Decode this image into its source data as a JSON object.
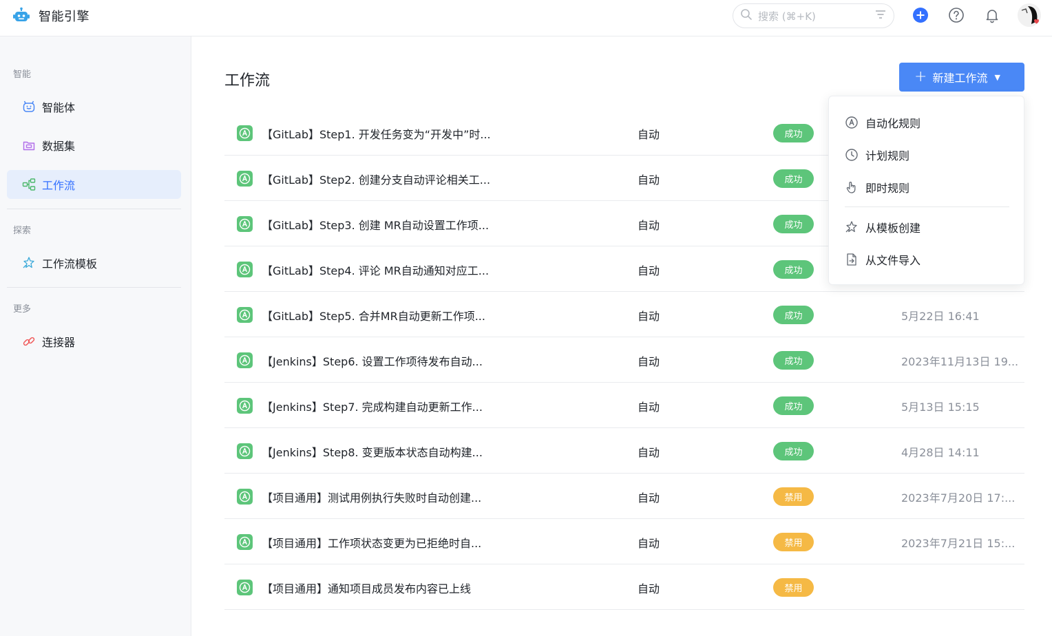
{
  "app": {
    "title": "智能引擎"
  },
  "search": {
    "placeholder": "搜索 (⌘+K)"
  },
  "sidebar": {
    "sections": [
      {
        "label": "智能"
      },
      {
        "label": "探索"
      },
      {
        "label": "更多"
      }
    ],
    "items": [
      {
        "label": "智能体",
        "icon": "robot-icon"
      },
      {
        "label": "数据集",
        "icon": "dataset-icon"
      },
      {
        "label": "工作流",
        "icon": "workflow-icon",
        "active": true
      },
      {
        "label": "工作流模板",
        "icon": "template-icon"
      },
      {
        "label": "连接器",
        "icon": "connector-icon"
      }
    ]
  },
  "main": {
    "title": "工作流",
    "new_button": {
      "label": "新建工作流"
    }
  },
  "dropdown": {
    "items": [
      {
        "label": "自动化规则",
        "icon": "auto-rule-icon"
      },
      {
        "label": "计划规则",
        "icon": "clock-icon"
      },
      {
        "label": "即时规则",
        "icon": "hand-icon"
      },
      {
        "label": "从模板创建",
        "icon": "template-sparkle-icon"
      },
      {
        "label": "从文件导入",
        "icon": "file-import-icon"
      }
    ]
  },
  "colors": {
    "accent": "#4a88f6",
    "success": "#5dc57a",
    "disabled": "#f5b945",
    "active_bg": "#e6eefc"
  },
  "workflows": [
    {
      "name": "【GitLab】Step1. 开发任务变为“开发中”时...",
      "type": "自动",
      "status": "成功",
      "status_kind": "success",
      "time": ""
    },
    {
      "name": "【GitLab】Step2. 创建分支自动评论相关工...",
      "type": "自动",
      "status": "成功",
      "status_kind": "success",
      "time": ""
    },
    {
      "name": "【GitLab】Step3. 创建 MR自动设置工作项...",
      "type": "自动",
      "status": "成功",
      "status_kind": "success",
      "time": ""
    },
    {
      "name": "【GitLab】Step4. 评论 MR自动通知对应工...",
      "type": "自动",
      "status": "成功",
      "status_kind": "success",
      "time": ""
    },
    {
      "name": "【GitLab】Step5. 合并MR自动更新工作项...",
      "type": "自动",
      "status": "成功",
      "status_kind": "success",
      "time": "5月22日 16:41"
    },
    {
      "name": "【Jenkins】Step6. 设置工作项待发布自动...",
      "type": "自动",
      "status": "成功",
      "status_kind": "success",
      "time": "2023年11月13日 19..."
    },
    {
      "name": "【Jenkins】Step7. 完成构建自动更新工作...",
      "type": "自动",
      "status": "成功",
      "status_kind": "success",
      "time": "5月13日 15:15"
    },
    {
      "name": "【Jenkins】Step8. 变更版本状态自动构建...",
      "type": "自动",
      "status": "成功",
      "status_kind": "success",
      "time": "4月28日 14:11"
    },
    {
      "name": "【项目通用】测试用例执行失败时自动创建...",
      "type": "自动",
      "status": "禁用",
      "status_kind": "disabled",
      "time": "2023年7月20日 17:..."
    },
    {
      "name": "【项目通用】工作项状态变更为已拒绝时自...",
      "type": "自动",
      "status": "禁用",
      "status_kind": "disabled",
      "time": "2023年7月21日 15:..."
    },
    {
      "name": "【项目通用】通知项目成员发布内容已上线",
      "type": "自动",
      "status": "禁用",
      "status_kind": "disabled",
      "time": ""
    }
  ]
}
